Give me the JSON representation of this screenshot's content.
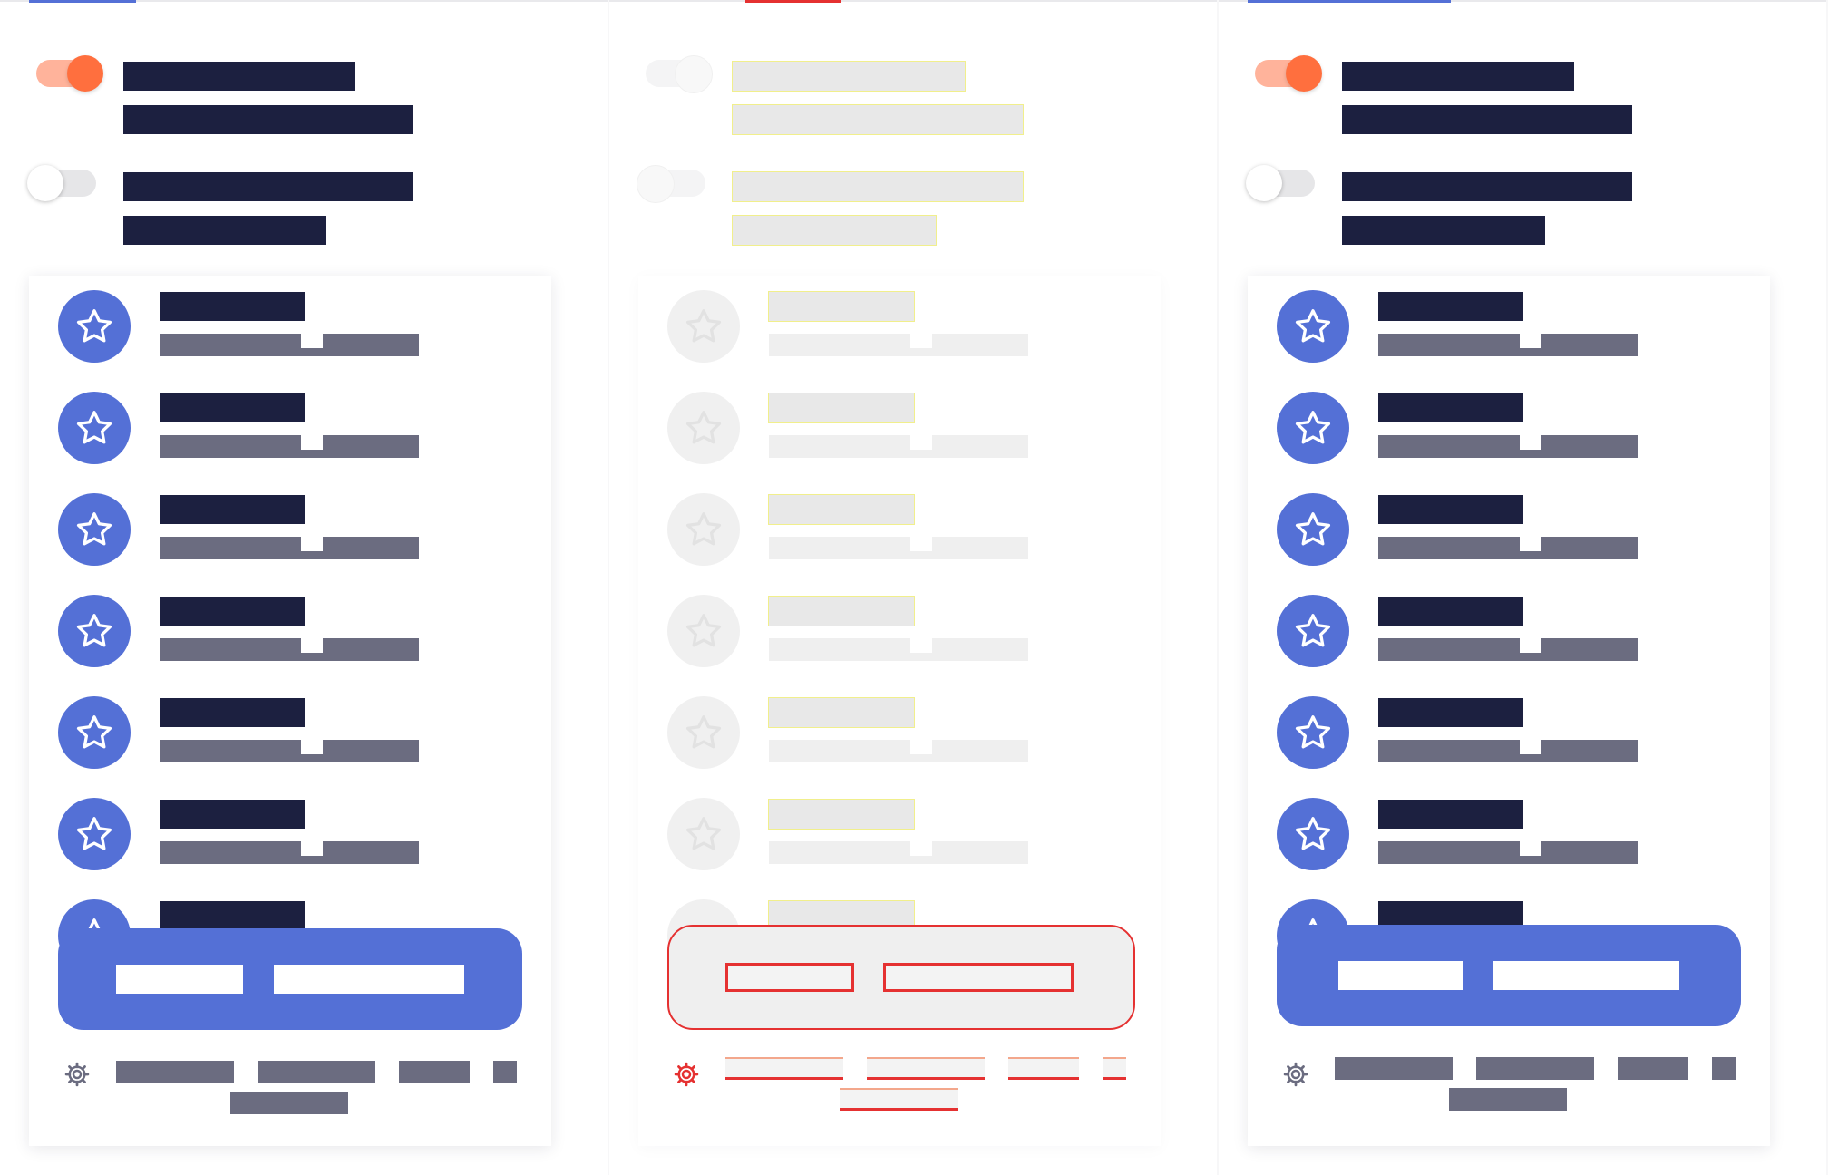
{
  "panels": [
    {
      "state": "default",
      "accent": "#5470d6",
      "toggles": [
        {
          "on": true
        },
        {
          "on": false
        }
      ]
    },
    {
      "state": "skeleton-loading",
      "accent": "#e53131",
      "toggles": [
        {
          "on": false
        },
        {
          "on": false
        }
      ]
    },
    {
      "state": "default",
      "accent": "#5470d6",
      "toggles": [
        {
          "on": true
        },
        {
          "on": false
        }
      ]
    }
  ],
  "list": {
    "item_icon": "star-icon",
    "item_count": 7
  },
  "cta": {
    "buttons": 2
  },
  "footer": {
    "icon": "gear-icon"
  },
  "colors": {
    "primary": "#5470d6",
    "toggle_on": "#ff6f3e",
    "toggle_on_track": "#ffb39b",
    "text_dark": "#1c2040",
    "text_muted": "#6b6c80",
    "error_outline": "#e53131"
  }
}
